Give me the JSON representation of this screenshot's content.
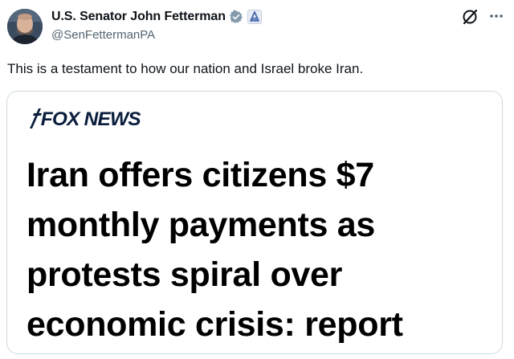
{
  "author": {
    "display_name": "U.S. Senator John Fetterman",
    "handle": "@SenFettermanPA",
    "verified_icon": "verified-badge-icon",
    "affiliation_icon": "government-badge-icon"
  },
  "actions": {
    "grok_icon": "grok-icon",
    "more_icon": "more-options-icon"
  },
  "tweet": {
    "text": "This is a testament to how our nation and Israel broke Iran."
  },
  "card": {
    "source_logo": "FOX NEWS",
    "headline_lines": [
      "Iran offers citizens $7",
      "monthly payments as",
      "protests spiral over",
      "economic crisis: report"
    ]
  },
  "colors": {
    "text_primary": "#0f1419",
    "text_secondary": "#536471",
    "border": "#cfd9de",
    "verified_gray": "#829aab",
    "fox_navy": "#0a1e3c"
  }
}
